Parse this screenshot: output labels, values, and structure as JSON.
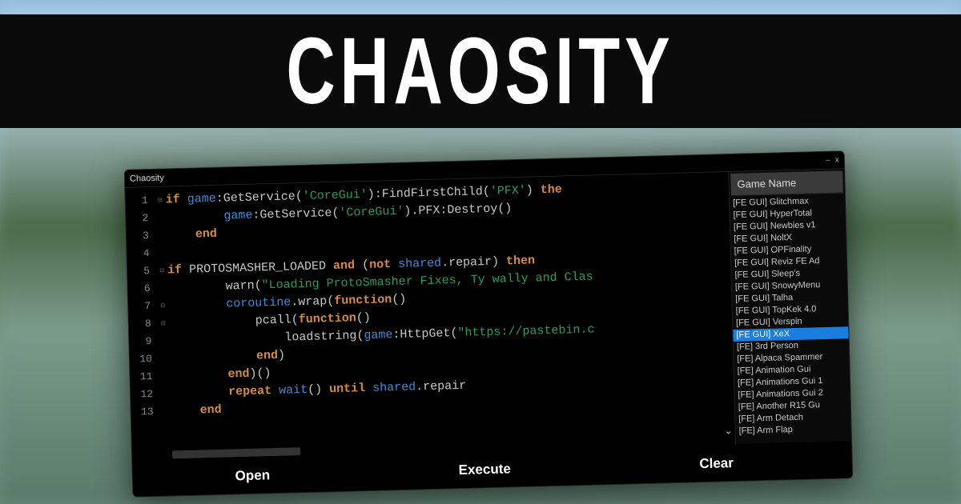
{
  "banner": {
    "title": "CHAOSITY"
  },
  "window": {
    "title": "Chaosity",
    "controls": {
      "minimize": "–",
      "close": "x"
    }
  },
  "code": {
    "lines": [
      {
        "n": 1,
        "fold": "⊟",
        "segs": [
          [
            "kw",
            "if "
          ],
          [
            "glob",
            "game"
          ],
          [
            "op",
            ":GetService("
          ],
          [
            "str",
            "'CoreGui'"
          ],
          [
            "op",
            "):FindFirstChild("
          ],
          [
            "str",
            "'PFX'"
          ],
          [
            "op",
            ") "
          ],
          [
            "kw",
            "the"
          ]
        ]
      },
      {
        "n": 2,
        "fold": "",
        "indent": 2,
        "segs": [
          [
            "glob",
            "game"
          ],
          [
            "op",
            ":GetService("
          ],
          [
            "str",
            "'CoreGui'"
          ],
          [
            "op",
            ").PFX:Destroy()"
          ]
        ]
      },
      {
        "n": 3,
        "fold": "",
        "indent": 1,
        "segs": [
          [
            "kw",
            "end"
          ]
        ]
      },
      {
        "n": 4,
        "fold": "",
        "segs": []
      },
      {
        "n": 5,
        "fold": "⊟",
        "segs": [
          [
            "kw",
            "if "
          ],
          [
            "func",
            "PROTOSMASHER_LOADED "
          ],
          [
            "kw",
            "and "
          ],
          [
            "op",
            "("
          ],
          [
            "kw",
            "not "
          ],
          [
            "glob",
            "shared"
          ],
          [
            "op",
            ".repair) "
          ],
          [
            "kw",
            "then"
          ]
        ]
      },
      {
        "n": 6,
        "fold": "",
        "indent": 2,
        "segs": [
          [
            "func",
            "warn"
          ],
          [
            "op",
            "("
          ],
          [
            "str",
            "\"Loading ProtoSmasher Fixes, Ty wally and Clas"
          ]
        ]
      },
      {
        "n": 7,
        "fold": "⊟",
        "indent": 2,
        "segs": [
          [
            "glob",
            "coroutine"
          ],
          [
            "op",
            ".wrap("
          ],
          [
            "kw",
            "function"
          ],
          [
            "op",
            "()"
          ]
        ]
      },
      {
        "n": 8,
        "fold": "⊟",
        "indent": 3,
        "segs": [
          [
            "func",
            "pcall"
          ],
          [
            "op",
            "("
          ],
          [
            "kw",
            "function"
          ],
          [
            "op",
            "()"
          ]
        ]
      },
      {
        "n": 9,
        "fold": "",
        "indent": 4,
        "segs": [
          [
            "func",
            "loadstring"
          ],
          [
            "op",
            "("
          ],
          [
            "glob",
            "game"
          ],
          [
            "op",
            ":HttpGet("
          ],
          [
            "str",
            "\"https://pastebin.c"
          ]
        ]
      },
      {
        "n": 10,
        "fold": "",
        "indent": 3,
        "segs": [
          [
            "kw",
            "end"
          ],
          [
            "op",
            ")"
          ]
        ]
      },
      {
        "n": 11,
        "fold": "",
        "indent": 2,
        "segs": [
          [
            "kw",
            "end"
          ],
          [
            "op",
            ")()"
          ]
        ]
      },
      {
        "n": 12,
        "fold": "",
        "indent": 2,
        "segs": [
          [
            "kw",
            "repeat "
          ],
          [
            "glob",
            "wait"
          ],
          [
            "op",
            "() "
          ],
          [
            "kw",
            "until "
          ],
          [
            "glob",
            "shared"
          ],
          [
            "op",
            ".repair"
          ]
        ]
      },
      {
        "n": 13,
        "fold": "",
        "indent": 1,
        "segs": [
          [
            "kw",
            "end"
          ]
        ]
      }
    ]
  },
  "sidebar": {
    "header": "Game Name",
    "items": [
      "[FE GUI] Glitchmax",
      "[FE GUI] HyperTotal",
      "[FE GUI] Newbies v1",
      "[FE GUI] NoltX",
      "[FE GUI] OPFinality",
      "[FE GUI] Reviz FE Ad",
      "[FE GUI] Sleep's",
      "[FE GUI] SnowyMenu",
      "[FE GUI] Talha",
      "[FE GUI] TopKek 4.0",
      "[FE GUI] Verspin",
      "[FE GUI] XeX",
      "[FE] 3rd Person",
      "[FE] Alpaca Spammer",
      "[FE] Animation Gui",
      "[FE] Animations Gui 1",
      "[FE] Animations Gui 2",
      "[FE] Another R15 Gu",
      "[FE] Arm Detach",
      "[FE] Arm Flap"
    ],
    "selected_index": 11
  },
  "buttons": {
    "open": "Open",
    "execute": "Execute",
    "clear": "Clear"
  }
}
